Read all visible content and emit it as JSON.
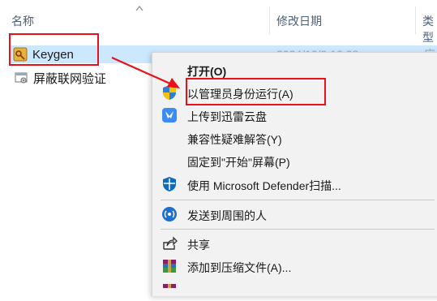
{
  "header": {
    "col_name": "名称",
    "col_date": "修改日期",
    "col_type": "类型"
  },
  "files": [
    {
      "name": "Keygen",
      "date": "2024/10/9 16:38",
      "type": "应用",
      "icon": "keygen-app-icon",
      "selected": true
    },
    {
      "name": "屏蔽联网验证",
      "date": "",
      "type": "",
      "icon": "batch-file-icon",
      "selected": false
    }
  ],
  "context_menu": {
    "items": [
      {
        "label": "打开(O)",
        "icon": "",
        "bold": true
      },
      {
        "label": "以管理员身份运行(A)",
        "icon": "uac-shield-icon"
      },
      {
        "label": "上传到迅雷云盘",
        "icon": "xunlei-icon"
      },
      {
        "label": "兼容性疑难解答(Y)",
        "icon": ""
      },
      {
        "label": "固定到\"开始\"屏幕(P)",
        "icon": ""
      },
      {
        "label": "使用 Microsoft Defender扫描...",
        "icon": "defender-shield-icon"
      },
      {
        "label": "发送到周围的人",
        "icon": "nearby-share-icon"
      },
      {
        "label": "共享",
        "icon": "share-icon"
      },
      {
        "label": "添加到压缩文件(A)...",
        "icon": "winrar-icon"
      }
    ]
  },
  "annotation_color": "#e8101b",
  "selection_color": "#cce8ff"
}
